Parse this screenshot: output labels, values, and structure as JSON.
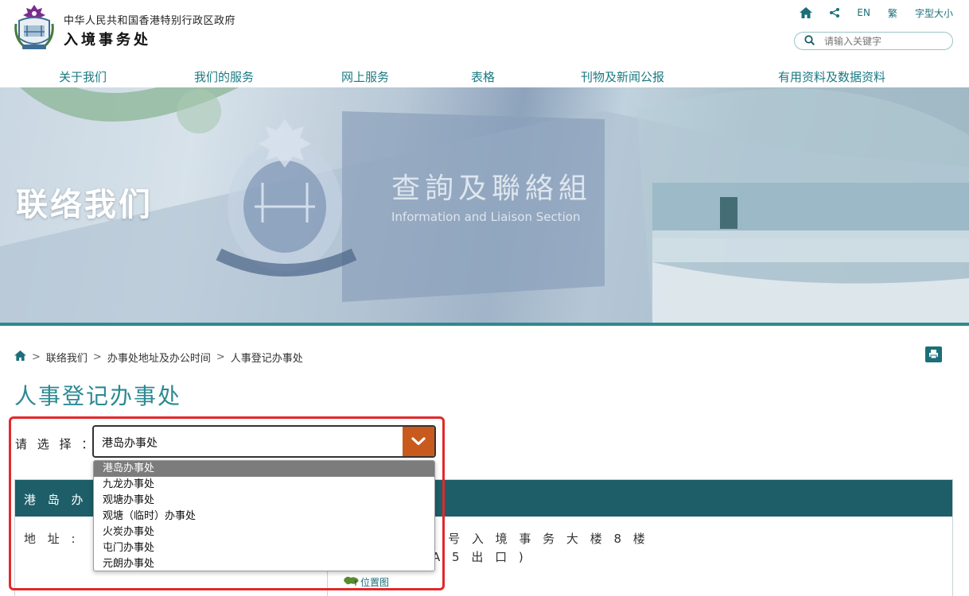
{
  "header": {
    "gov_name": "中华人民共和国香港特别行政区政府",
    "dept_name": "入境事务处",
    "tools": {
      "lang_en": "EN",
      "lang_tc": "繁",
      "font_size": "字型大小"
    },
    "search": {
      "placeholder": "请输入关键字"
    }
  },
  "nav": {
    "items": [
      {
        "label": "关于我们"
      },
      {
        "label": "我们的服务"
      },
      {
        "label": "网上服务"
      },
      {
        "label": "表格"
      },
      {
        "label": "刊物及新闻公报"
      },
      {
        "label": "有用资料及数据资料"
      }
    ]
  },
  "banner": {
    "title": "联络我们",
    "sign_cn": "查詢及聯絡組",
    "sign_en": "Information and Liaison Section"
  },
  "breadcrumb": {
    "items": [
      "联络我们",
      "办事处地址及办公时间",
      "人事登记办事处"
    ],
    "separator": ">"
  },
  "page": {
    "title": "人事登记办事处"
  },
  "selector": {
    "label": "请 选 择 ：",
    "value": "港岛办事处",
    "options": [
      "港岛办事处",
      "九龙办事处",
      "观塘办事处",
      "观塘（临时）办事处",
      "火炭办事处",
      "屯门办事处",
      "元朗办事处"
    ],
    "selected_index": 0
  },
  "office": {
    "header_visible": "港 岛 办 事",
    "address_label": "地 址 :",
    "address_line1_visible": "道 7 号 入 境 事 务 大 楼 8 楼",
    "address_line2_visible": "A 5 出 口 )",
    "map_link": "位置图"
  },
  "colors": {
    "teal": "#1a7a82",
    "dark_teal": "#1d5e68",
    "orange": "#c85a1e",
    "highlight_red": "#e3292b"
  }
}
